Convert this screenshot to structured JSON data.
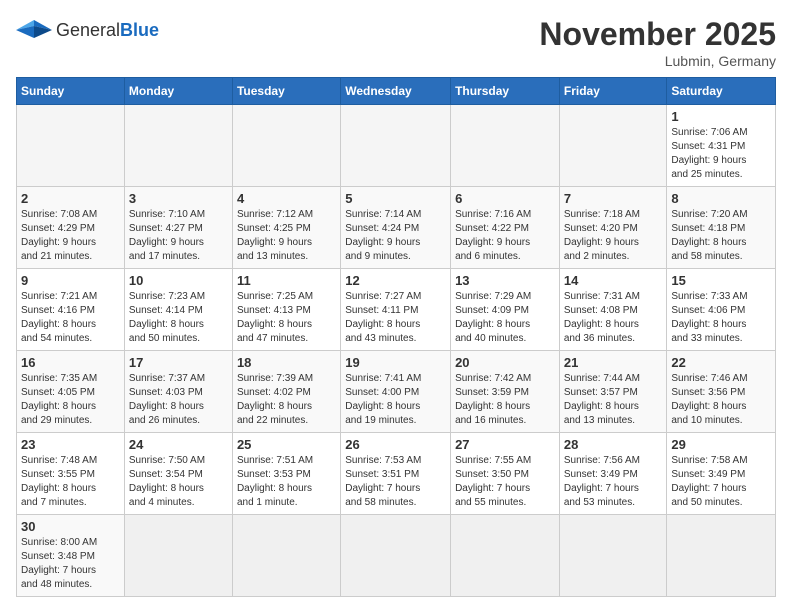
{
  "header": {
    "logo_text_general": "General",
    "logo_text_blue": "Blue",
    "month": "November 2025",
    "location": "Lubmin, Germany"
  },
  "weekdays": [
    "Sunday",
    "Monday",
    "Tuesday",
    "Wednesday",
    "Thursday",
    "Friday",
    "Saturday"
  ],
  "weeks": [
    [
      {
        "day": "",
        "info": ""
      },
      {
        "day": "",
        "info": ""
      },
      {
        "day": "",
        "info": ""
      },
      {
        "day": "",
        "info": ""
      },
      {
        "day": "",
        "info": ""
      },
      {
        "day": "",
        "info": ""
      },
      {
        "day": "1",
        "info": "Sunrise: 7:06 AM\nSunset: 4:31 PM\nDaylight: 9 hours\nand 25 minutes."
      }
    ],
    [
      {
        "day": "2",
        "info": "Sunrise: 7:08 AM\nSunset: 4:29 PM\nDaylight: 9 hours\nand 21 minutes."
      },
      {
        "day": "3",
        "info": "Sunrise: 7:10 AM\nSunset: 4:27 PM\nDaylight: 9 hours\nand 17 minutes."
      },
      {
        "day": "4",
        "info": "Sunrise: 7:12 AM\nSunset: 4:25 PM\nDaylight: 9 hours\nand 13 minutes."
      },
      {
        "day": "5",
        "info": "Sunrise: 7:14 AM\nSunset: 4:24 PM\nDaylight: 9 hours\nand 9 minutes."
      },
      {
        "day": "6",
        "info": "Sunrise: 7:16 AM\nSunset: 4:22 PM\nDaylight: 9 hours\nand 6 minutes."
      },
      {
        "day": "7",
        "info": "Sunrise: 7:18 AM\nSunset: 4:20 PM\nDaylight: 9 hours\nand 2 minutes."
      },
      {
        "day": "8",
        "info": "Sunrise: 7:20 AM\nSunset: 4:18 PM\nDaylight: 8 hours\nand 58 minutes."
      }
    ],
    [
      {
        "day": "9",
        "info": "Sunrise: 7:21 AM\nSunset: 4:16 PM\nDaylight: 8 hours\nand 54 minutes."
      },
      {
        "day": "10",
        "info": "Sunrise: 7:23 AM\nSunset: 4:14 PM\nDaylight: 8 hours\nand 50 minutes."
      },
      {
        "day": "11",
        "info": "Sunrise: 7:25 AM\nSunset: 4:13 PM\nDaylight: 8 hours\nand 47 minutes."
      },
      {
        "day": "12",
        "info": "Sunrise: 7:27 AM\nSunset: 4:11 PM\nDaylight: 8 hours\nand 43 minutes."
      },
      {
        "day": "13",
        "info": "Sunrise: 7:29 AM\nSunset: 4:09 PM\nDaylight: 8 hours\nand 40 minutes."
      },
      {
        "day": "14",
        "info": "Sunrise: 7:31 AM\nSunset: 4:08 PM\nDaylight: 8 hours\nand 36 minutes."
      },
      {
        "day": "15",
        "info": "Sunrise: 7:33 AM\nSunset: 4:06 PM\nDaylight: 8 hours\nand 33 minutes."
      }
    ],
    [
      {
        "day": "16",
        "info": "Sunrise: 7:35 AM\nSunset: 4:05 PM\nDaylight: 8 hours\nand 29 minutes."
      },
      {
        "day": "17",
        "info": "Sunrise: 7:37 AM\nSunset: 4:03 PM\nDaylight: 8 hours\nand 26 minutes."
      },
      {
        "day": "18",
        "info": "Sunrise: 7:39 AM\nSunset: 4:02 PM\nDaylight: 8 hours\nand 22 minutes."
      },
      {
        "day": "19",
        "info": "Sunrise: 7:41 AM\nSunset: 4:00 PM\nDaylight: 8 hours\nand 19 minutes."
      },
      {
        "day": "20",
        "info": "Sunrise: 7:42 AM\nSunset: 3:59 PM\nDaylight: 8 hours\nand 16 minutes."
      },
      {
        "day": "21",
        "info": "Sunrise: 7:44 AM\nSunset: 3:57 PM\nDaylight: 8 hours\nand 13 minutes."
      },
      {
        "day": "22",
        "info": "Sunrise: 7:46 AM\nSunset: 3:56 PM\nDaylight: 8 hours\nand 10 minutes."
      }
    ],
    [
      {
        "day": "23",
        "info": "Sunrise: 7:48 AM\nSunset: 3:55 PM\nDaylight: 8 hours\nand 7 minutes."
      },
      {
        "day": "24",
        "info": "Sunrise: 7:50 AM\nSunset: 3:54 PM\nDaylight: 8 hours\nand 4 minutes."
      },
      {
        "day": "25",
        "info": "Sunrise: 7:51 AM\nSunset: 3:53 PM\nDaylight: 8 hours\nand 1 minute."
      },
      {
        "day": "26",
        "info": "Sunrise: 7:53 AM\nSunset: 3:51 PM\nDaylight: 7 hours\nand 58 minutes."
      },
      {
        "day": "27",
        "info": "Sunrise: 7:55 AM\nSunset: 3:50 PM\nDaylight: 7 hours\nand 55 minutes."
      },
      {
        "day": "28",
        "info": "Sunrise: 7:56 AM\nSunset: 3:49 PM\nDaylight: 7 hours\nand 53 minutes."
      },
      {
        "day": "29",
        "info": "Sunrise: 7:58 AM\nSunset: 3:49 PM\nDaylight: 7 hours\nand 50 minutes."
      }
    ],
    [
      {
        "day": "30",
        "info": "Sunrise: 8:00 AM\nSunset: 3:48 PM\nDaylight: 7 hours\nand 48 minutes."
      },
      {
        "day": "",
        "info": ""
      },
      {
        "day": "",
        "info": ""
      },
      {
        "day": "",
        "info": ""
      },
      {
        "day": "",
        "info": ""
      },
      {
        "day": "",
        "info": ""
      },
      {
        "day": "",
        "info": ""
      }
    ]
  ]
}
